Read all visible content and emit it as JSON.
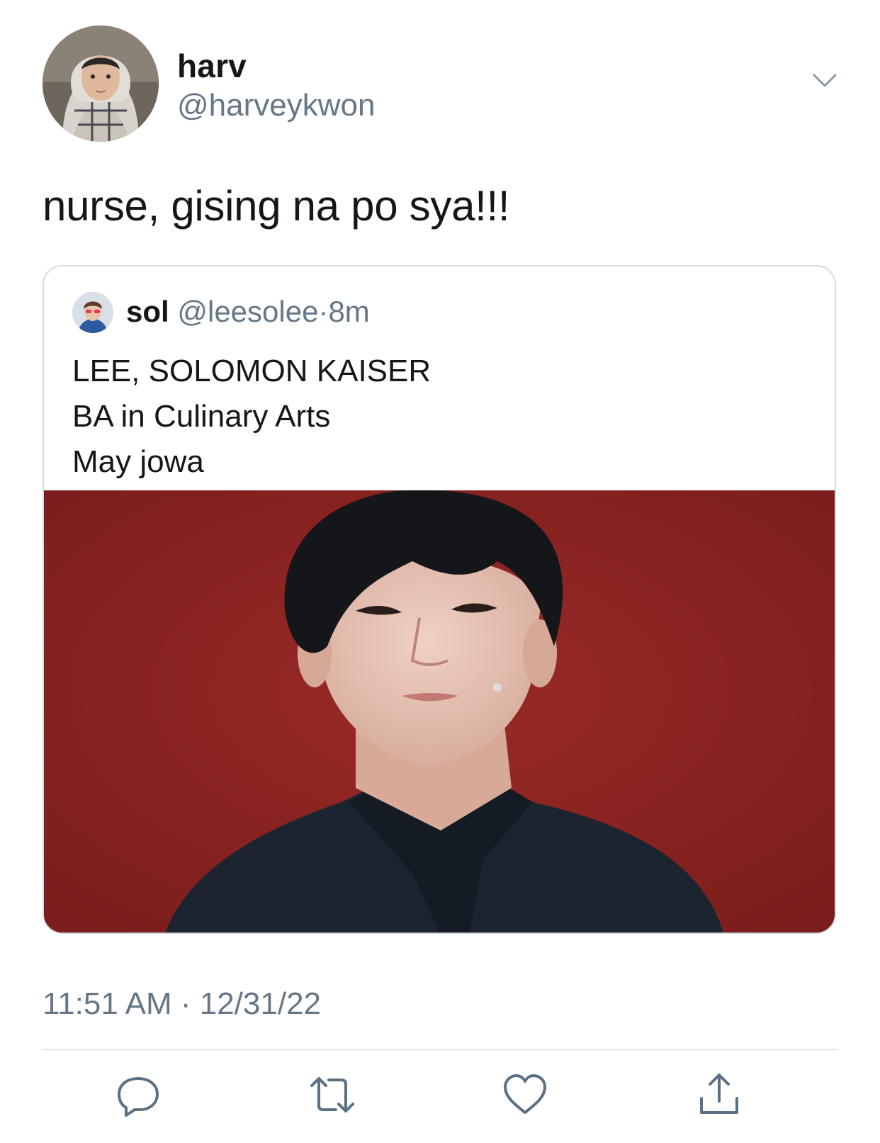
{
  "author": {
    "display_name": "harv",
    "handle": "@harveykwon"
  },
  "tweet": {
    "text": "nurse, gising na po sya!!!",
    "timestamp": "11:51 AM · 12/31/22"
  },
  "quoted_tweet": {
    "display_name": "sol",
    "handle": "@leesolee",
    "separator": "·",
    "age": "8m",
    "lines": [
      "LEE, SOLOMON KAISER",
      "BA in Culinary Arts",
      "May jowa"
    ]
  },
  "icons": {
    "menu": "chevron-down-icon",
    "reply": "reply-icon",
    "retweet": "retweet-icon",
    "like": "heart-icon",
    "share": "share-icon"
  },
  "colors": {
    "text_primary": "#14171a",
    "text_secondary": "#657786",
    "border": "#d4dbe1",
    "action_icon": "#5b7083",
    "photo_background": "#8c2423"
  }
}
